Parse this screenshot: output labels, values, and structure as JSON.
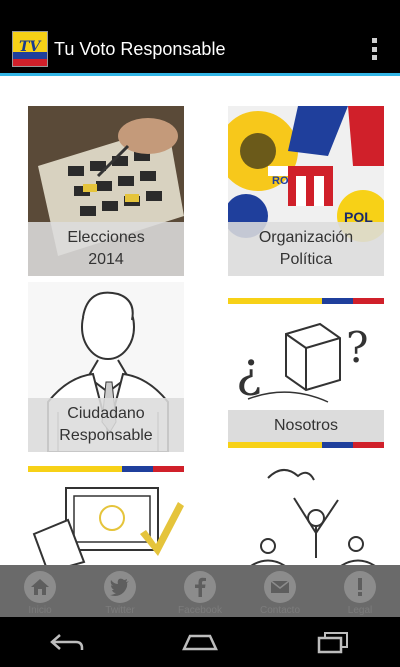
{
  "app": {
    "title": "Tu Voto Responsable",
    "logo_text": "TV"
  },
  "tiles": [
    {
      "label": "Elecciones\n2014"
    },
    {
      "label": "Organización\nPolítica"
    },
    {
      "label": "Ciudadano\nResponsable"
    },
    {
      "label": "Nosotros"
    },
    {
      "label": ""
    },
    {
      "label": ""
    }
  ],
  "tile2_art": {
    "sign1": "RO",
    "sign2": "POL"
  },
  "bottom_nav": [
    {
      "label": "Inicio",
      "icon": "home-icon"
    },
    {
      "label": "Twitter",
      "icon": "twitter-icon"
    },
    {
      "label": "Facebook",
      "icon": "facebook-icon"
    },
    {
      "label": "Contacto",
      "icon": "mail-icon"
    },
    {
      "label": "Legal",
      "icon": "alert-icon"
    }
  ],
  "colors": {
    "accent": "#33b5e5",
    "flag_yellow": "#f7d117",
    "flag_blue": "#1f3f9c",
    "flag_red": "#d0202a",
    "bottom_nav_bg": "#6a6a6a"
  }
}
